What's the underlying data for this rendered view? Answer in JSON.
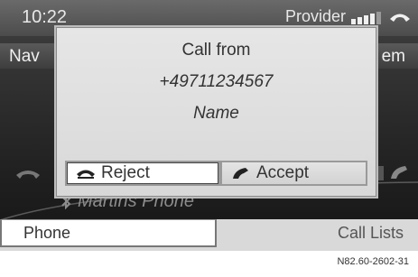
{
  "status": {
    "time": "10:22",
    "provider": "Provider"
  },
  "menu": {
    "nav": "Nav",
    "system": "em"
  },
  "background": {
    "device_name": "Martins Phone"
  },
  "popup": {
    "title": "Call from",
    "number": "+49711234567",
    "name": "Name",
    "reject_label": "Reject",
    "accept_label": "Accept"
  },
  "tabs": {
    "phone": "Phone",
    "call_lists": "Call Lists"
  },
  "footer": {
    "reference": "N82.60-2602-31"
  },
  "icons": {
    "reject": "phone-hangup-icon",
    "accept": "phone-handset-icon",
    "signal": "signal-strength-icon",
    "device": "bluetooth-icon"
  }
}
